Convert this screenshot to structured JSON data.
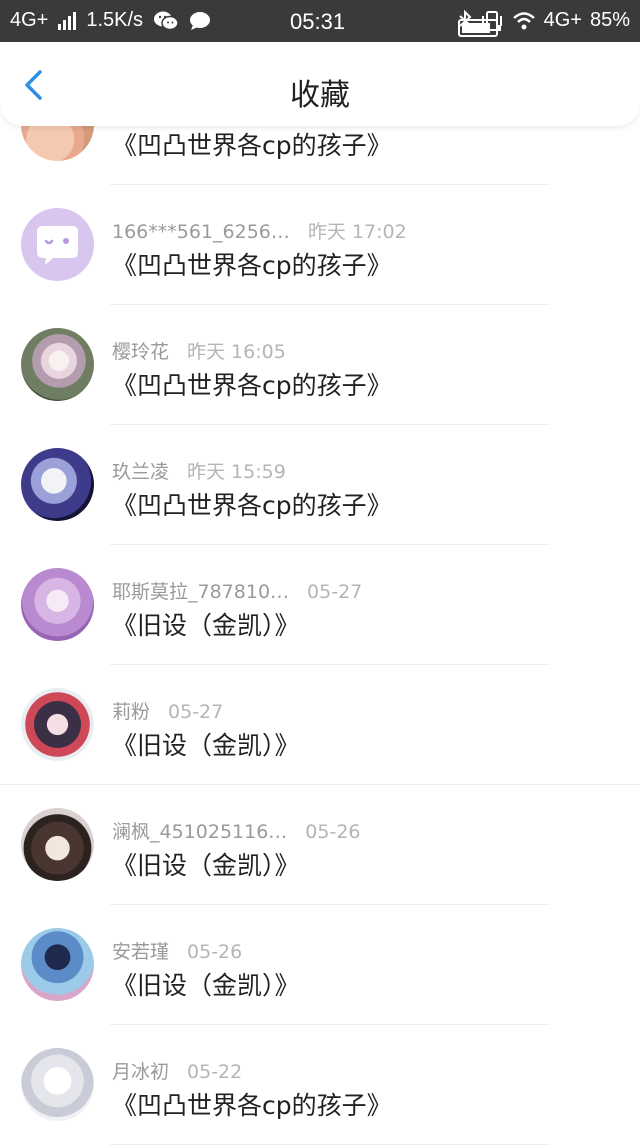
{
  "status_bar": {
    "network": "4G+",
    "speed": "1.5K/s",
    "time": "05:31",
    "network_right": "4G+",
    "battery": "85%"
  },
  "header": {
    "title": "收藏"
  },
  "colors": {
    "accent": "#2f8fe8",
    "status_bg": "#3a3a3a",
    "name_gray": "#9a9a9a",
    "text": "#222222"
  },
  "items": [
    {
      "name": "",
      "time": "",
      "content": "《凹凸世界各cp的孩子》",
      "avatar": "avatar-photo"
    },
    {
      "name": "166***561_6256…",
      "time": "昨天 17:02",
      "content": "《凹凸世界各cp的孩子》",
      "avatar": "chat-bubble-avatar"
    },
    {
      "name": "樱玲花",
      "time": "昨天 16:05",
      "content": "《凹凸世界各cp的孩子》",
      "avatar": "anime-girl-avatar"
    },
    {
      "name": "玖兰凌",
      "time": "昨天 15:59",
      "content": "《凹凸世界各cp的孩子》",
      "avatar": "anime-avatar-dark"
    },
    {
      "name": "耶斯莫拉_787810…",
      "time": "05-27",
      "content": "《旧设（金凯）》",
      "avatar": "anime-avatar-purple"
    },
    {
      "name": "莉粉",
      "time": "05-27",
      "content": "《旧设（金凯）》",
      "avatar": "anime-avatar-red"
    },
    {
      "name": "澜枫_451025116…",
      "time": "05-26",
      "content": "《旧设（金凯）》",
      "avatar": "anime-avatar-boy"
    },
    {
      "name": "安若瑾",
      "time": "05-26",
      "content": "《旧设（金凯）》",
      "avatar": "anime-avatar-blue"
    },
    {
      "name": "月冰初",
      "time": "05-22",
      "content": "《凹凸世界各cp的孩子》",
      "avatar": "anime-avatar-white"
    }
  ]
}
